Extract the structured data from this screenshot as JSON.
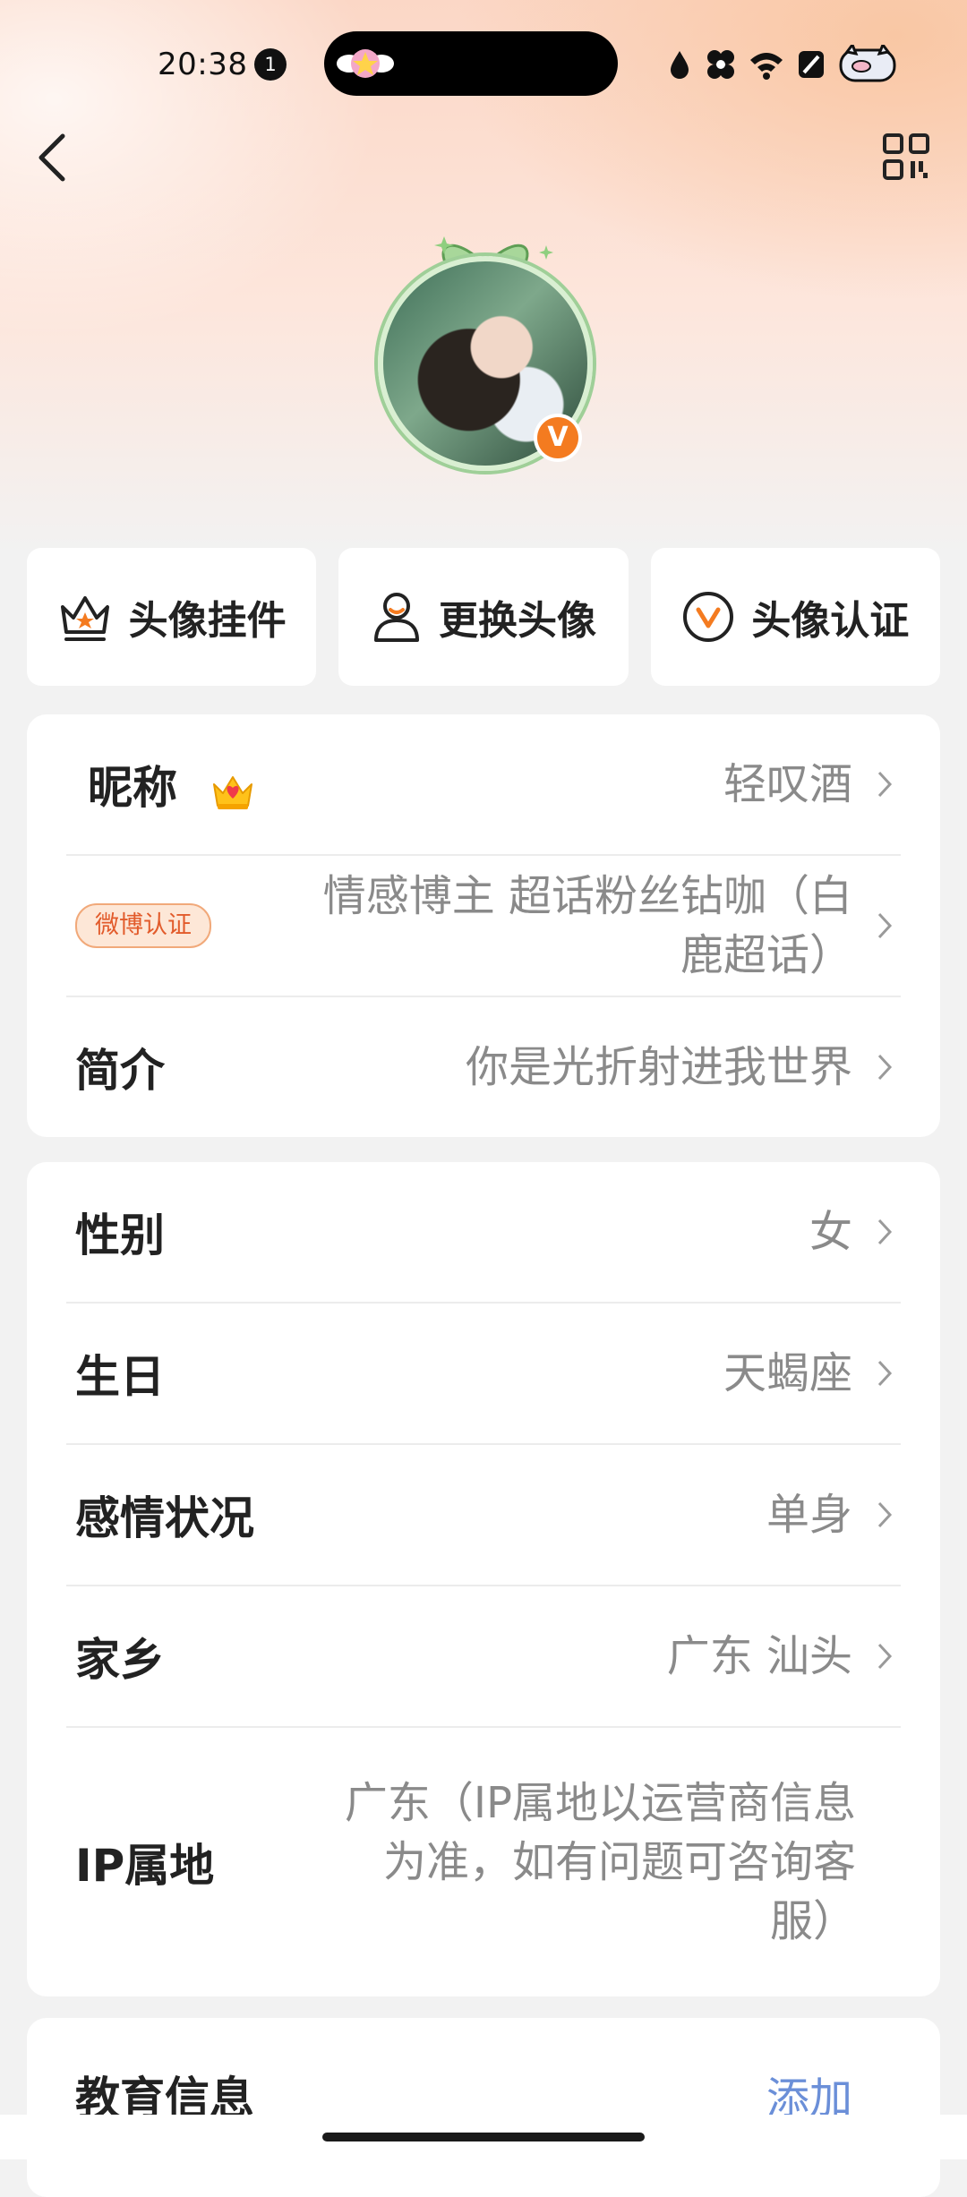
{
  "status_bar": {
    "time": "20:38",
    "notification_count": "1",
    "icons": [
      "drop-icon",
      "bluetooth-icon",
      "wifi-icon",
      "mute-icon",
      "pig-icon"
    ]
  },
  "header": {
    "back_icon": "chevron-left-icon",
    "qr_icon": "qr-code-icon"
  },
  "avatar": {
    "verified_mark": "V",
    "badge_color": "#f47b20"
  },
  "actions": [
    {
      "label": "头像挂件",
      "icon": "crown-frame-icon"
    },
    {
      "label": "更换头像",
      "icon": "person-icon"
    },
    {
      "label": "头像认证",
      "icon": "v-circle-icon"
    }
  ],
  "profile": {
    "nickname": {
      "label": "昵称",
      "value": "轻叹酒",
      "icon": "crown-icon"
    },
    "weibo_cert": {
      "tag": "微博认证",
      "value_line1": "情感博主 超话粉丝钻咖（白",
      "value_line2": "鹿超话）"
    },
    "bio": {
      "label": "简介",
      "value": "你是光折射进我世界"
    }
  },
  "details": {
    "gender": {
      "label": "性别",
      "value": "女"
    },
    "birthday": {
      "label": "生日",
      "value": "天蝎座"
    },
    "relationship": {
      "label": "感情状况",
      "value": "单身"
    },
    "hometown": {
      "label": "家乡",
      "value": "广东 汕头"
    },
    "ip": {
      "label": "IP属地",
      "value_line1": "广东（IP属地以运营商信息",
      "value_line2": "为准，如有问题可咨询客",
      "value_line3": "服）"
    }
  },
  "education": {
    "label": "教育信息",
    "action": "添加"
  },
  "colors": {
    "accent": "#f47b20",
    "link": "#6b8fd8"
  }
}
